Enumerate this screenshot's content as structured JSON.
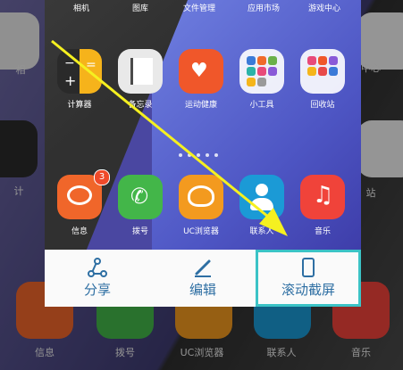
{
  "preview": {
    "top_labels": [
      "相机",
      "图库",
      "文件管理",
      "应用市场",
      "游戏中心"
    ],
    "row1": [
      {
        "name": "calculator",
        "label": "计算器",
        "color": "#2a2a2a"
      },
      {
        "name": "notes",
        "label": "备忘录",
        "color": "#e9e9e9"
      },
      {
        "name": "health",
        "label": "运动健康",
        "color": "#f0572a"
      },
      {
        "name": "tools",
        "label": "小工具",
        "color": "#ffffff"
      },
      {
        "name": "recycle",
        "label": "回收站",
        "color": "#ffffff"
      }
    ],
    "badge_count": "3",
    "row2": [
      {
        "name": "messages",
        "label": "信息",
        "color": "#f0662a"
      },
      {
        "name": "phone",
        "label": "拨号",
        "color": "#43b649"
      },
      {
        "name": "uc-browser",
        "label": "UC浏览器",
        "color": "#f39a1f"
      },
      {
        "name": "contacts",
        "label": "联系人",
        "color": "#1b9ad6"
      },
      {
        "name": "music",
        "label": "音乐",
        "color": "#f0433a"
      }
    ]
  },
  "actions": {
    "share": "分享",
    "edit": "编辑",
    "scroll_screenshot": "滚动截屏"
  },
  "background": {
    "labels_bottom": [
      "信息",
      "拨号",
      "UC浏览器",
      "联系人",
      "音乐"
    ],
    "partial_left": [
      "相",
      "计"
    ],
    "partial_right": [
      "中心",
      "站"
    ]
  },
  "colors": {
    "highlight": "#3bc3c6",
    "action_text": "#2e6fa3",
    "arrow": "#f5f020"
  }
}
